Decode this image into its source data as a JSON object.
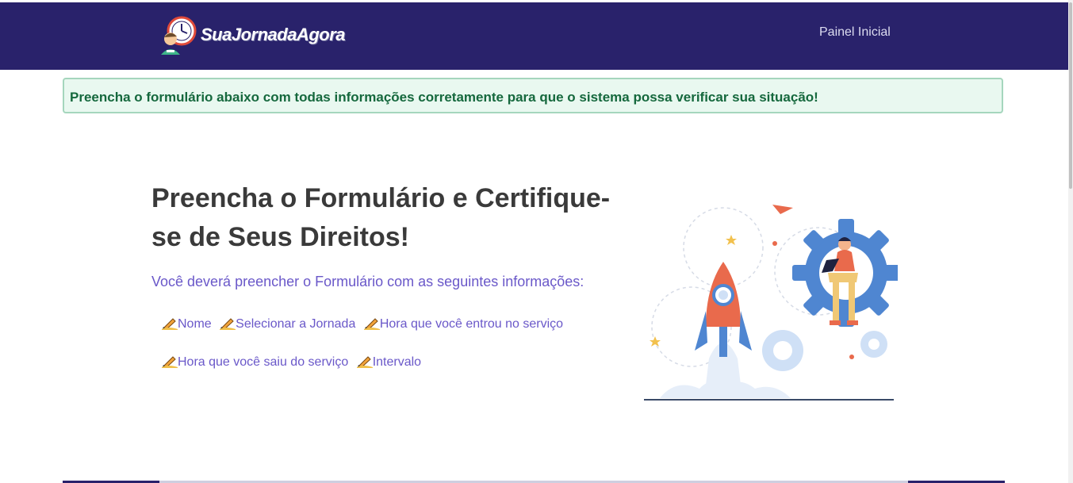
{
  "navbar": {
    "brand": "SuaJornadaAgora",
    "links": [
      "Painel Inicial"
    ],
    "color": "#29226b"
  },
  "alert": {
    "text": "Preencha o formulário abaixo com todas informações corretamente para que o sistema possa verificar sua situação!",
    "color": "#15683d"
  },
  "hero": {
    "title": "Preencha o Formulário e Certifique-se de Seus Direitos!",
    "subtitle": "Você deverá preencher o Formulário com as seguintes informações:",
    "items": [
      "Nome",
      "Selecionar a Jornada",
      "Hora que você entrou no serviço",
      "Hora que você saiu do serviço",
      "Intervalo"
    ],
    "item_icon": "writing-hand-icon",
    "accent": "#6a58c9"
  }
}
